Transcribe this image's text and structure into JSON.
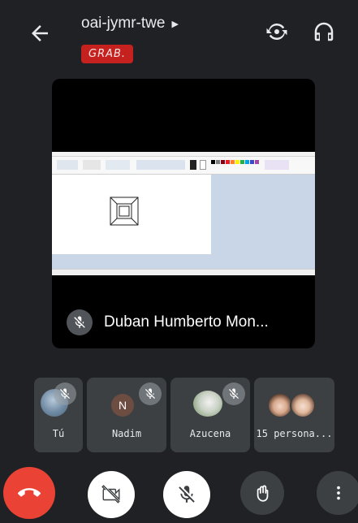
{
  "meeting": {
    "code": "oai-jymr-twe",
    "recording_badge": "GRAB."
  },
  "main_tile": {
    "participant_name": "Duban Humberto Mon...",
    "muted": true,
    "content": "screen-share-paint"
  },
  "participants": [
    {
      "label": "Tú",
      "muted": true,
      "avatar": "photo"
    },
    {
      "label": "Nadim",
      "muted": true,
      "avatar": "initial",
      "initial": "N"
    },
    {
      "label": "Azucena",
      "muted": true,
      "avatar": "photo"
    },
    {
      "label": "15 persona...",
      "muted": false,
      "avatar": "group"
    }
  ],
  "icons": {
    "back": "arrow-left-icon",
    "switch_camera": "switch-camera-icon",
    "audio": "headphones-icon",
    "end_call": "phone-hangup-icon",
    "camera": "video-off-icon",
    "microphone": "mic-off-icon",
    "raise_hand": "hand-icon",
    "more": "more-vertical-icon"
  },
  "colors": {
    "background": "#202124",
    "tile": "#3c4043",
    "end_call": "#ea4335",
    "recording": "#c5221f",
    "avatar_nadim": "#6d4c41",
    "white_button": "#ffffff"
  }
}
